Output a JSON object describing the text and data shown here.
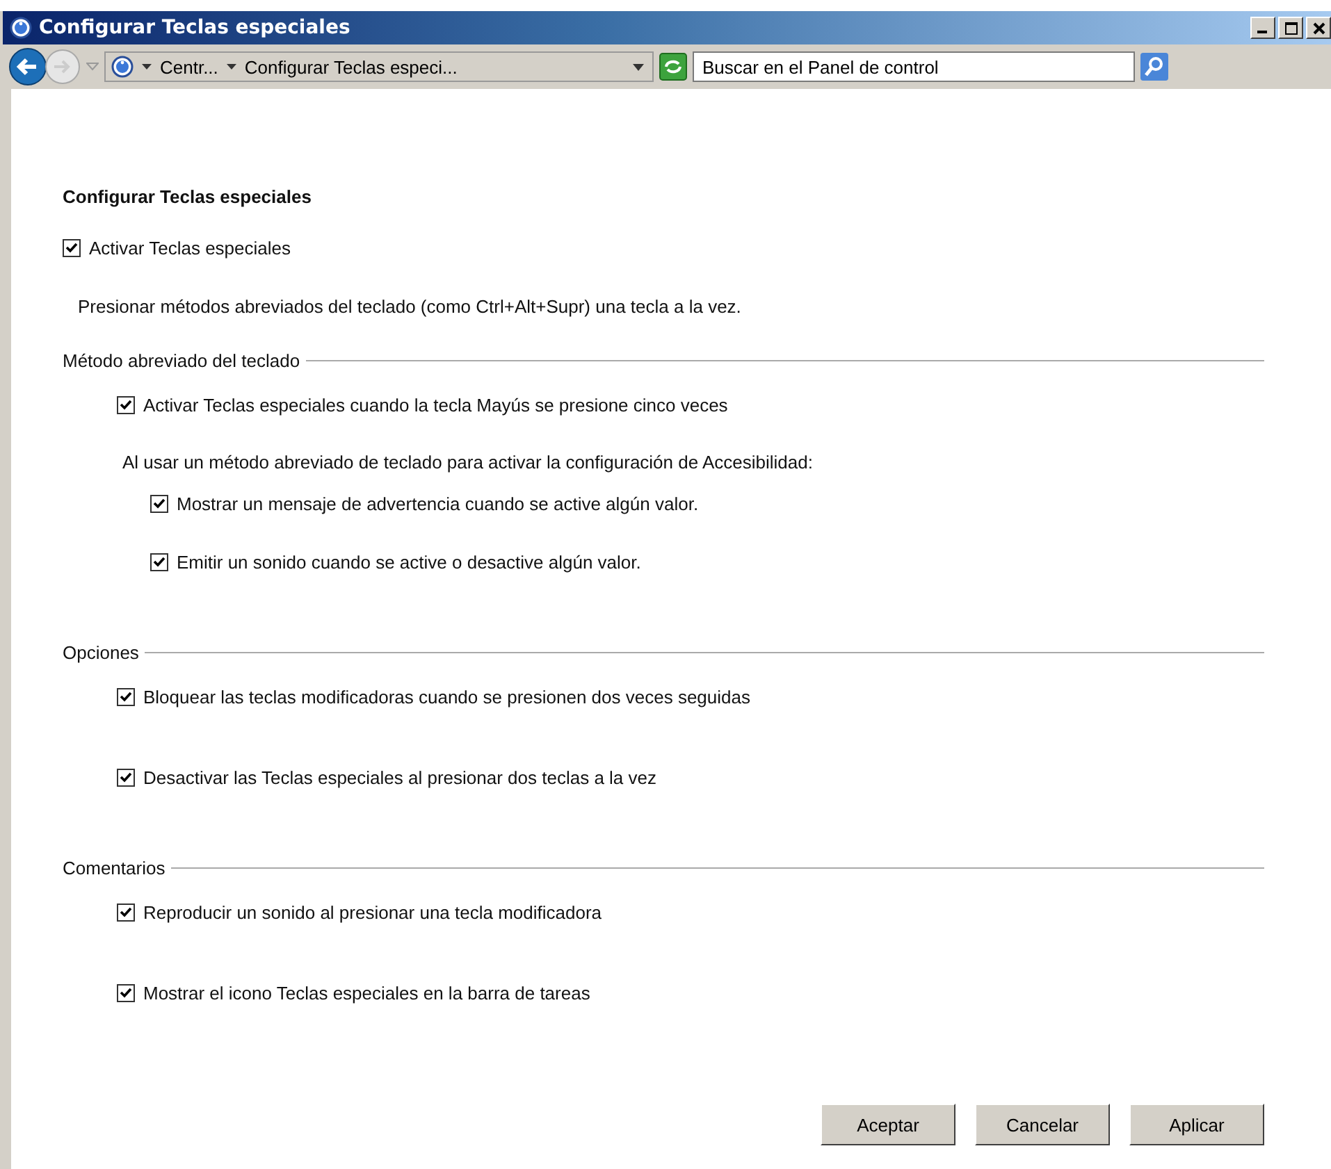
{
  "window": {
    "title": "Configurar Teclas especiales"
  },
  "nav": {
    "breadcrumbs": [
      "Centr...",
      "Configurar Teclas especi..."
    ],
    "search": {
      "placeholder": "Buscar en el Panel de control"
    }
  },
  "heading": "Configurar Teclas especiales",
  "main_option": {
    "label": "Activar Teclas especiales",
    "checked": true
  },
  "description": "Presionar métodos abreviados del teclado (como Ctrl+Alt+Supr) una tecla a la vez.",
  "sections": [
    {
      "title": "Método abreviado del teclado",
      "items": [
        {
          "kind": "checkbox",
          "label": "Activar Teclas especiales cuando la tecla Mayús se presione cinco veces",
          "checked": true,
          "children": [
            {
              "kind": "note",
              "label": "Al usar un método abreviado de teclado para activar la configuración de Accesibilidad:"
            },
            {
              "kind": "checkbox",
              "label": "Mostrar un mensaje de advertencia cuando se active algún valor.",
              "checked": true
            },
            {
              "kind": "checkbox",
              "label": "Emitir un sonido cuando se active o desactive algún valor.",
              "checked": true
            }
          ]
        }
      ]
    },
    {
      "title": "Opciones",
      "items": [
        {
          "kind": "checkbox",
          "label": "Bloquear las teclas modificadoras cuando se presionen dos veces seguidas",
          "checked": true
        },
        {
          "kind": "checkbox",
          "label": "Desactivar las Teclas especiales al presionar dos teclas a la vez",
          "checked": true
        }
      ]
    },
    {
      "title": "Comentarios",
      "items": [
        {
          "kind": "checkbox",
          "label": "Reproducir un sonido al presionar una tecla modificadora",
          "checked": true
        },
        {
          "kind": "checkbox",
          "label": "Mostrar el icono Teclas especiales en la barra de tareas",
          "checked": true
        }
      ]
    }
  ],
  "buttons": [
    "Aceptar",
    "Cancelar",
    "Aplicar"
  ]
}
